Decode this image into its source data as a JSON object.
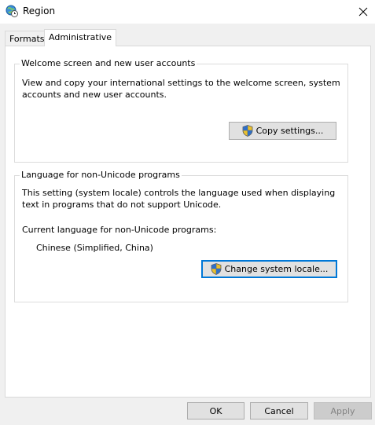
{
  "window": {
    "title": "Region"
  },
  "tabs": [
    {
      "label": "Formats"
    },
    {
      "label": "Administrative"
    }
  ],
  "welcome_group": {
    "legend": "Welcome screen and new user accounts",
    "description_line1": "View and copy your international settings to the welcome screen, system",
    "description_line2": "accounts and new user accounts.",
    "copy_button_label": "Copy settings..."
  },
  "language_group": {
    "legend": "Language for non-Unicode programs",
    "description_line1": "This setting (system locale) controls the language used when displaying",
    "description_line2": "text in programs that do not support Unicode.",
    "current_label": "Current language for non-Unicode programs:",
    "current_value": "Chinese (Simplified, China)",
    "change_button_label": "Change system locale..."
  },
  "footer": {
    "ok_label": "OK",
    "cancel_label": "Cancel",
    "apply_label": "Apply"
  },
  "icons": {
    "title": "globe-clock-icon",
    "close": "close-icon",
    "shield": "uac-shield-icon"
  }
}
